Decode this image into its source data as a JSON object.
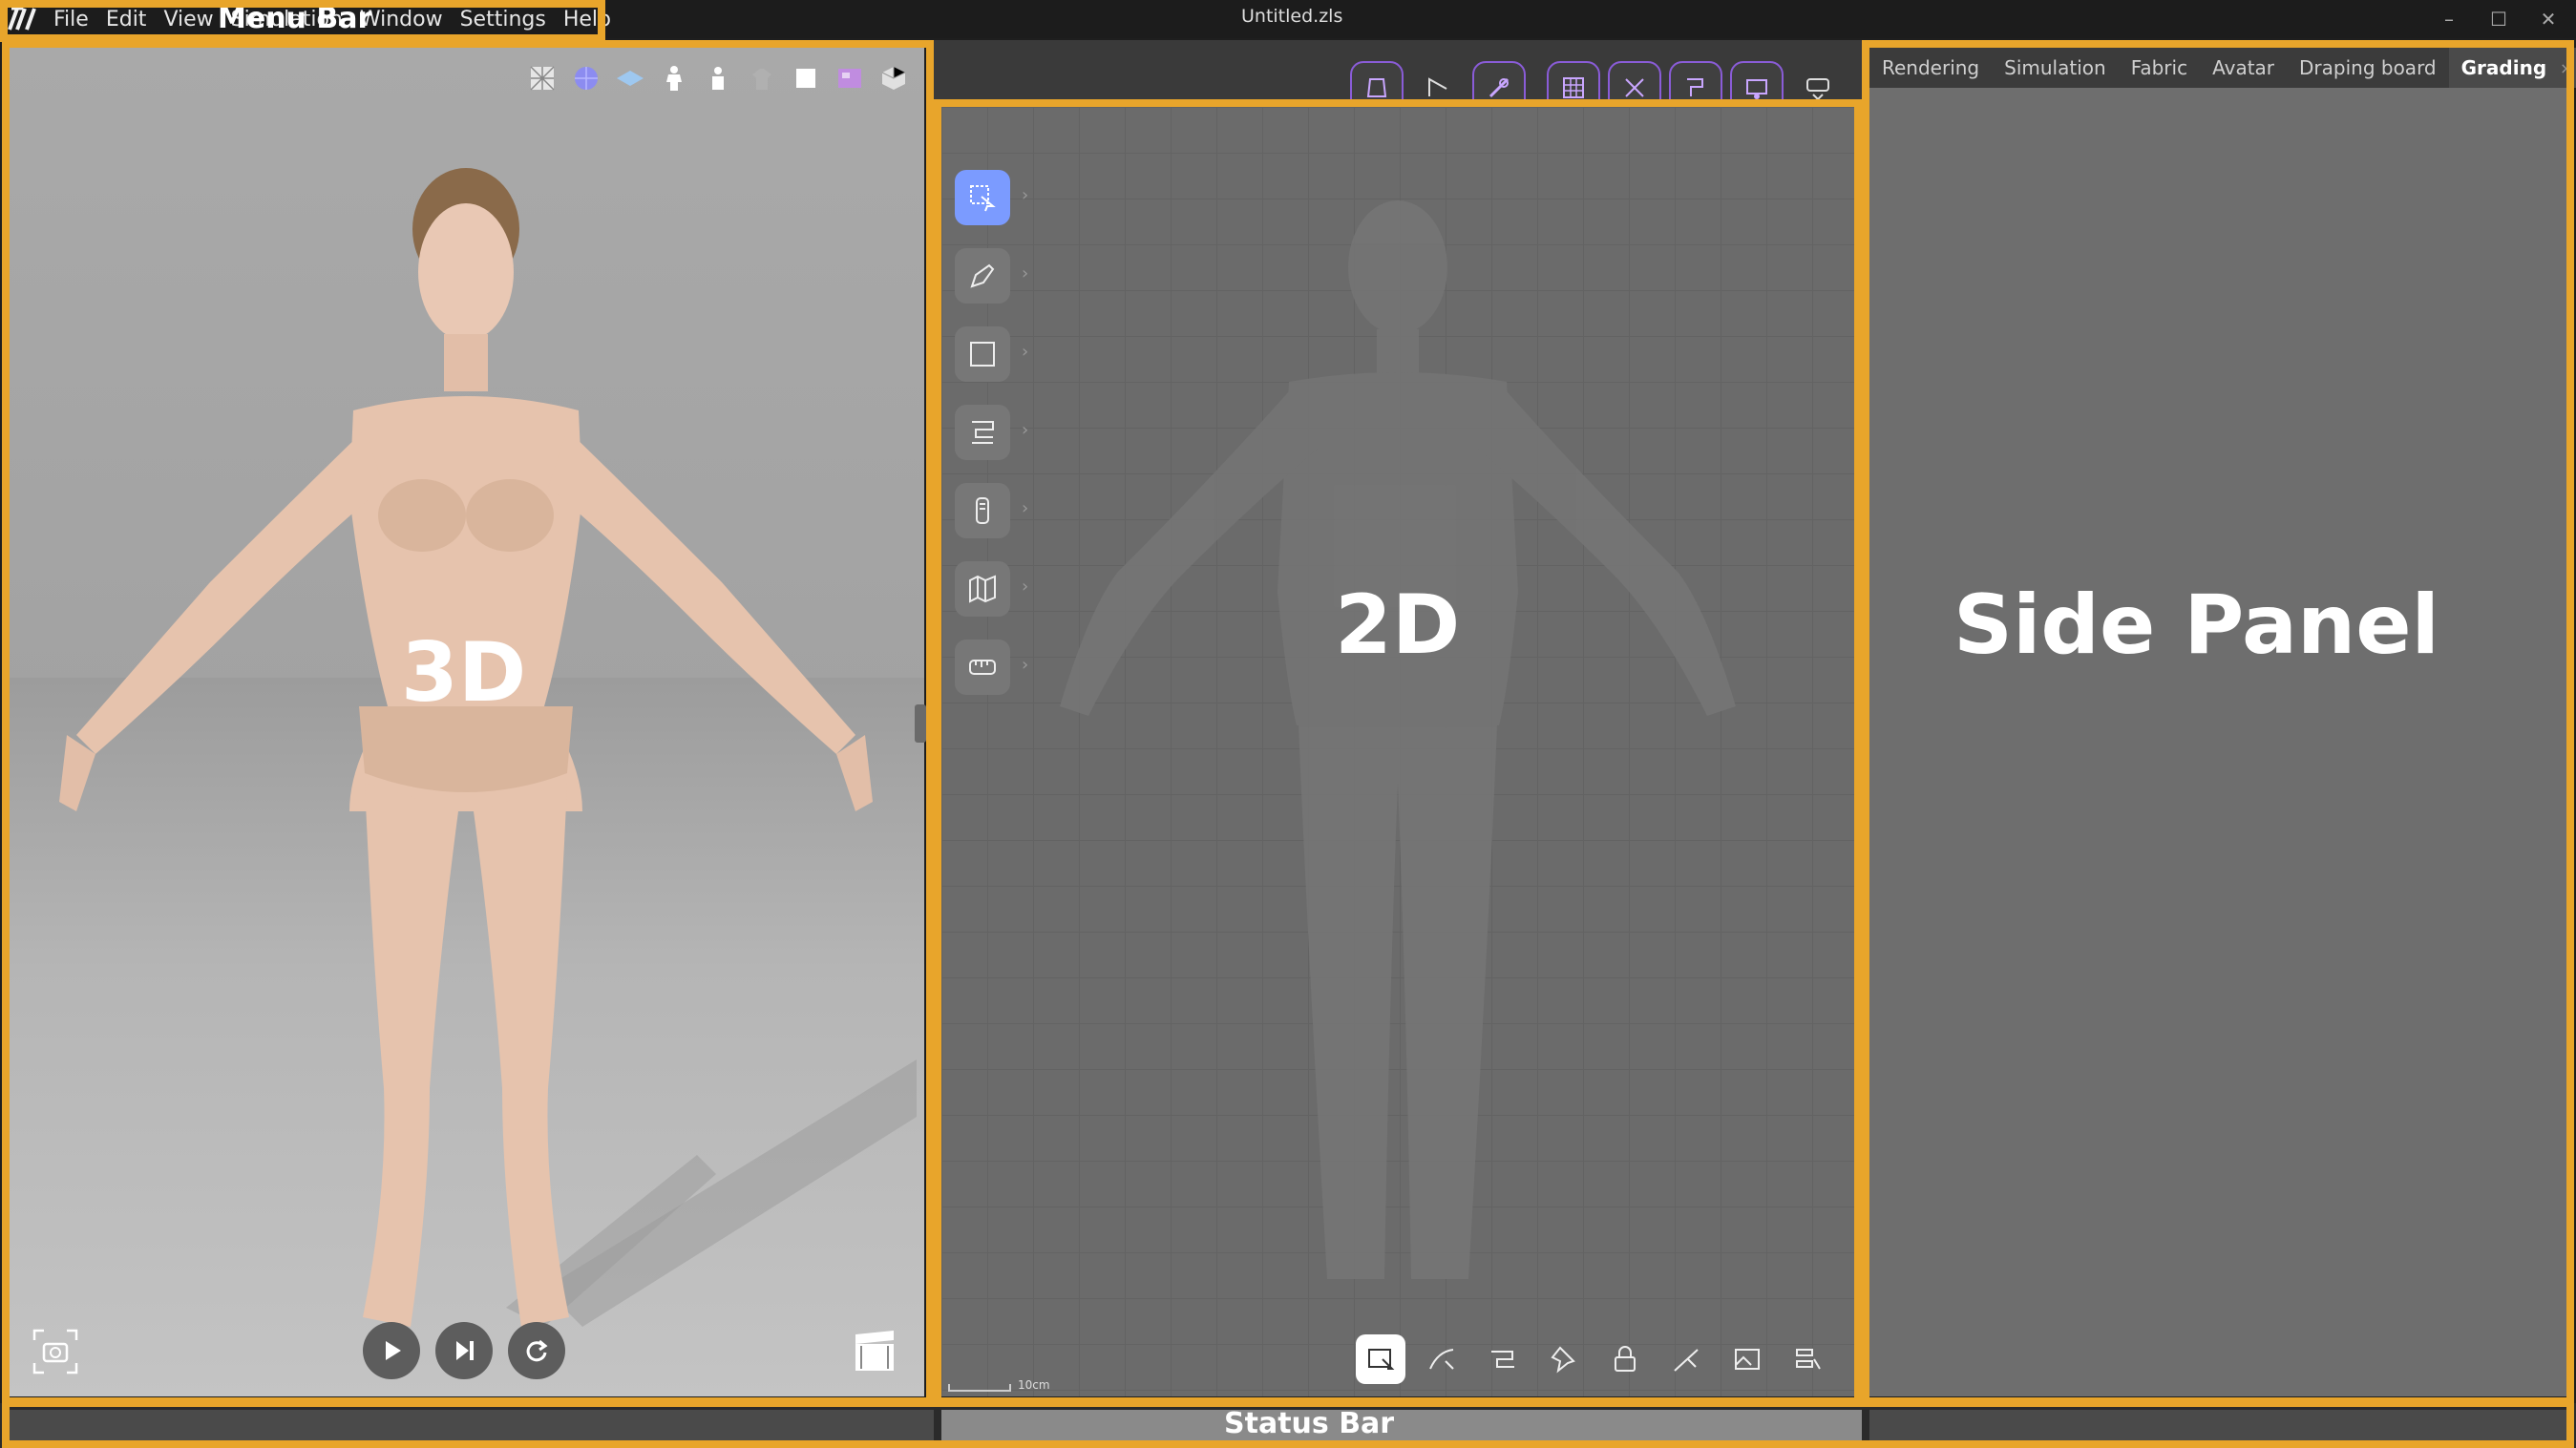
{
  "app": {
    "document_title": "Untitled.zls",
    "menu": [
      "File",
      "Edit",
      "View",
      "Simulation",
      "Window",
      "Settings",
      "Help"
    ],
    "window_controls": {
      "minimize": "–",
      "maximize": "☐",
      "close": "✕"
    }
  },
  "annotations": {
    "menu_bar": "Menu Bar",
    "viewport_3d": "3D",
    "viewport_2d": "2D",
    "side_panel": "Side Panel",
    "status_bar": "Status Bar"
  },
  "viewport_3d": {
    "toolbar_icons": [
      "mesh-grid-icon",
      "sphere-icon",
      "plane-icon",
      "avatar-icon",
      "avatar-alt-icon",
      "garment-icon",
      "cube-white-icon",
      "texture-icon",
      "cube-view-icon"
    ],
    "playback": [
      "play-icon",
      "step-forward-icon",
      "reset-icon"
    ],
    "camera_icon": "camera-icon",
    "record_icon": "clapperboard-icon"
  },
  "viewport_2d": {
    "top_toolbar_icons": [
      "pattern-icon",
      "segment-icon",
      "sew-icon",
      "grid-icon",
      "cut-icon",
      "stitch-icon",
      "board-icon",
      "fold-icon"
    ],
    "left_tools": [
      "transform-icon",
      "pen-icon",
      "rectangle-icon",
      "sewing-icon",
      "zipper-icon",
      "fold-map-icon",
      "measure-icon"
    ],
    "bottom_toolbar_icons": [
      "select-icon",
      "edit-curve-icon",
      "sewing-tool-icon",
      "pin-icon",
      "lock-icon",
      "line-icon",
      "image-icon",
      "settings-icon"
    ],
    "scale_label": "10cm"
  },
  "side_panel": {
    "tabs": [
      "Rendering",
      "Simulation",
      "Fabric",
      "Avatar",
      "Draping board",
      "Grading"
    ],
    "active_tab": "Grading",
    "close_glyph": "×",
    "more_glyph": "⌄"
  },
  "colors": {
    "highlight": "#e8a52b",
    "accent_purple": "#8a5cd8",
    "active_tool": "#7b9bff"
  }
}
